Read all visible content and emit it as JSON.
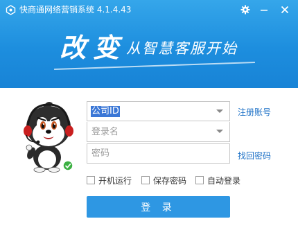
{
  "titlebar": {
    "app_title": "快商通网络营销系统 4.1.4.43",
    "icons": [
      "app-logo-icon",
      "gear-icon",
      "minimize-icon",
      "close-icon"
    ]
  },
  "banner": {
    "slogan_big": "改变",
    "slogan_small": "从智慧客服开始"
  },
  "form": {
    "company_id": {
      "value": "公司ID",
      "placeholder": "公司ID"
    },
    "login_name": {
      "value": "",
      "placeholder": "登录名"
    },
    "password": {
      "value": "",
      "placeholder": "密码"
    },
    "register_link": "注册账号",
    "recover_link": "找回密码",
    "options": {
      "auto_start": {
        "label": "开机运行",
        "checked": false
      },
      "save_password": {
        "label": "保存密码",
        "checked": false
      },
      "auto_login": {
        "label": "自动登录",
        "checked": false
      }
    },
    "login_button": "登 录"
  },
  "colors": {
    "header_top": "#35a6ea",
    "header_bottom": "#1883d6",
    "button": "#2e97e3",
    "link": "#1a6fc6",
    "selection": "#3b77d6",
    "status_online": "#3cb043"
  }
}
